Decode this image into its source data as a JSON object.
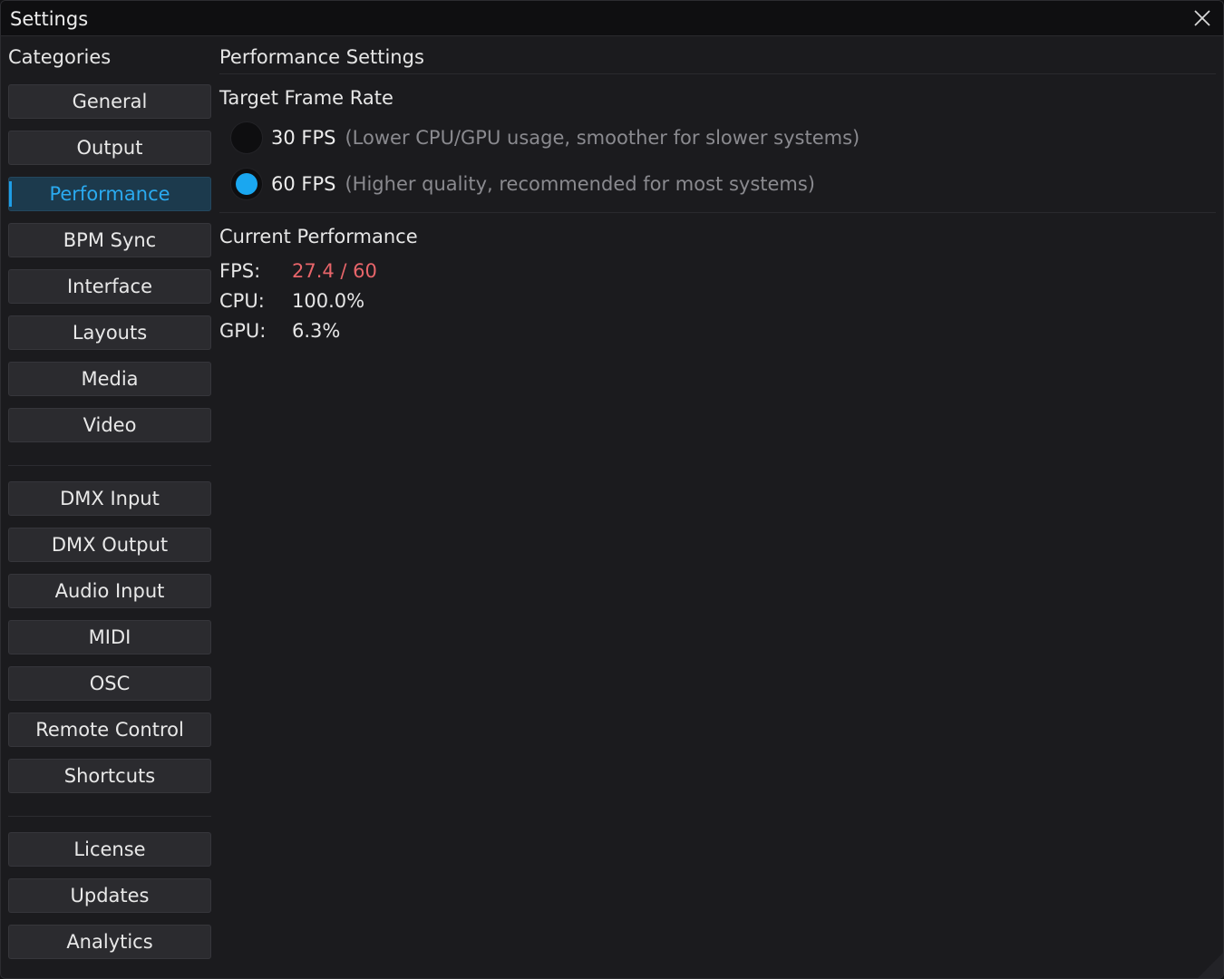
{
  "window": {
    "title": "Settings"
  },
  "sidebar": {
    "heading": "Categories",
    "groups": [
      [
        "General",
        "Output",
        "Performance",
        "BPM Sync",
        "Interface",
        "Layouts",
        "Media",
        "Video"
      ],
      [
        "DMX Input",
        "DMX Output",
        "Audio Input",
        "MIDI",
        "OSC",
        "Remote Control",
        "Shortcuts"
      ],
      [
        "License",
        "Updates",
        "Analytics"
      ]
    ],
    "items": {
      "general": "General",
      "output": "Output",
      "performance": "Performance",
      "bpm_sync": "BPM Sync",
      "interface": "Interface",
      "layouts": "Layouts",
      "media": "Media",
      "video": "Video",
      "dmx_input": "DMX Input",
      "dmx_output": "DMX Output",
      "audio_input": "Audio Input",
      "midi": "MIDI",
      "osc": "OSC",
      "remote_control": "Remote Control",
      "shortcuts": "Shortcuts",
      "license": "License",
      "updates": "Updates",
      "analytics": "Analytics"
    },
    "active": "Performance"
  },
  "main": {
    "title": "Performance Settings",
    "frame_rate": {
      "heading": "Target Frame Rate",
      "options": [
        {
          "label": "30 FPS",
          "description": "(Lower CPU/GPU usage, smoother for slower systems)",
          "selected": false
        },
        {
          "label": "60 FPS",
          "description": "(Higher quality, recommended for most systems)",
          "selected": true
        }
      ]
    },
    "current": {
      "heading": "Current Performance",
      "fps_label": "FPS:",
      "fps_value": "27.4 / 60",
      "cpu_label": "CPU:",
      "cpu_value": "100.0%",
      "gpu_label": "GPU:",
      "gpu_value": "6.3%"
    }
  },
  "colors": {
    "accent": "#1aa7f0",
    "warning": "#e8656a",
    "background": "#1b1b1e"
  },
  "icons": {
    "close": "close-icon"
  }
}
